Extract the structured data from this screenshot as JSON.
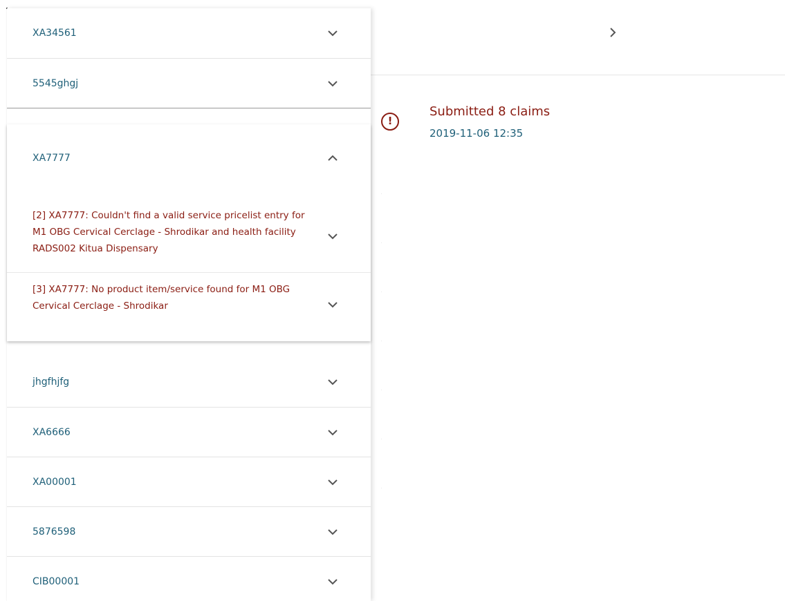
{
  "left_list": {
    "items_top": [
      {
        "label": "XA34561"
      },
      {
        "label": "5545ghgj"
      }
    ],
    "expanded": {
      "label": "XA7777",
      "sub_items": [
        {
          "message": "[2] XA7777: Couldn't find a valid service pricelist entry for M1 OBG Cervical Cerclage - Shrodikar and health facility RADS002 Kitua Dispensary"
        },
        {
          "message": "[3] XA7777: No product item/service found for M1 OBG Cervical Cerclage - Shrodikar"
        }
      ]
    },
    "items_bottom": [
      {
        "label": "jhgfhjfg"
      },
      {
        "label": "XA6666"
      },
      {
        "label": "XA00001"
      },
      {
        "label": "5876598"
      },
      {
        "label": "CIB00001"
      }
    ]
  },
  "notice": {
    "icon": "alert-circle-icon",
    "title": "Submitted 8 claims",
    "timestamp": "2019-11-06 12:35"
  },
  "colors": {
    "label": "#1e5f78",
    "error": "#8a1c12",
    "divider": "#e3e3e3"
  }
}
